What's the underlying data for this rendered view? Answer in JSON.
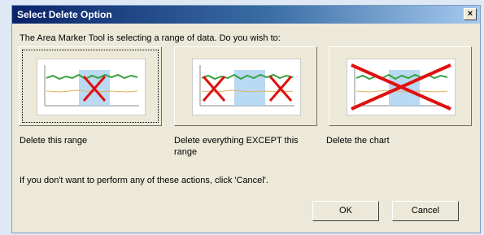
{
  "dialog": {
    "title": "Select Delete Option",
    "close_label": "×",
    "prompt": "The Area Marker Tool is selecting a range of data.  Do you wish to:",
    "options": [
      {
        "label": "Delete this range"
      },
      {
        "label": "Delete everything EXCEPT this range"
      },
      {
        "label": "Delete the chart"
      }
    ],
    "info": "If you don't want to perform any of these actions, click 'Cancel'.",
    "ok_label": "OK",
    "cancel_label": "Cancel"
  }
}
